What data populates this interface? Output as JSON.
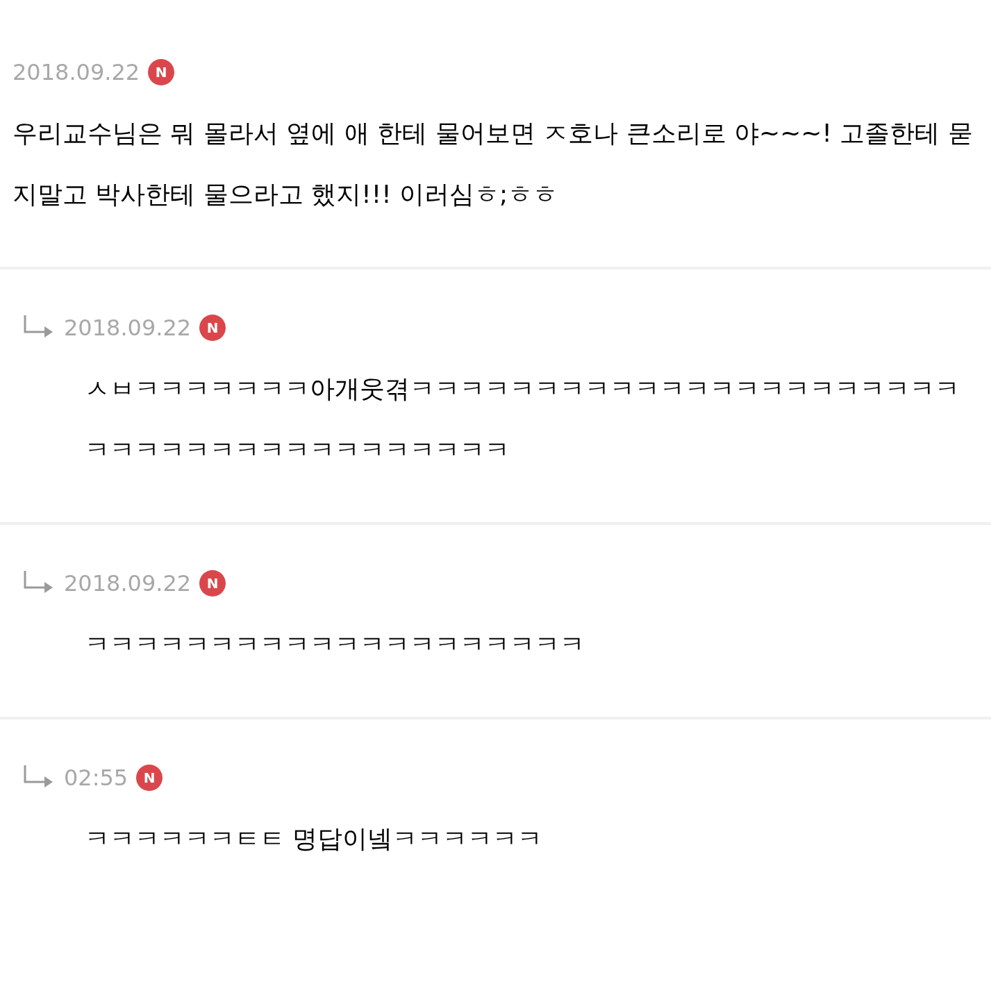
{
  "comments": [
    {
      "kind": "comment",
      "date": "2018.09.22",
      "badge": "N",
      "text": "우리교수님은 뭐 몰라서 옆에 애 한테 물어보면 ㅈ호나 큰소리로 야~~~! 고졸한테 묻지말고 박사한테 물으라고 했지!!! 이러심ㅎ;ㅎㅎ"
    },
    {
      "kind": "reply",
      "date": "2018.09.22",
      "badge": "N",
      "text": "ㅅㅂㅋㅋㅋㅋㅋㅋㅋ아개웃겪ㅋㅋㅋㅋㅋㅋㅋㅋㅋㅋㅋㅋㅋㅋㅋㅋㅋㅋㅋㅋㅋㅋㅋㅋㅋㅋㅋㅋㅋㅋㅋㅋㅋㅋㅋㅋㅋㅋㅋ"
    },
    {
      "kind": "reply",
      "date": "2018.09.22",
      "badge": "N",
      "text": "ㅋㅋㅋㅋㅋㅋㅋㅋㅋㅋㅋㅋㅋㅋㅋㅋㅋㅋㅋㅋ"
    },
    {
      "kind": "reply",
      "date": "02:55",
      "badge": "N",
      "text": "ㅋㅋㅋㅋㅋㅋㅌㅌ 명답이넼ㅋㅋㅋㅋㅋㅋ"
    }
  ]
}
